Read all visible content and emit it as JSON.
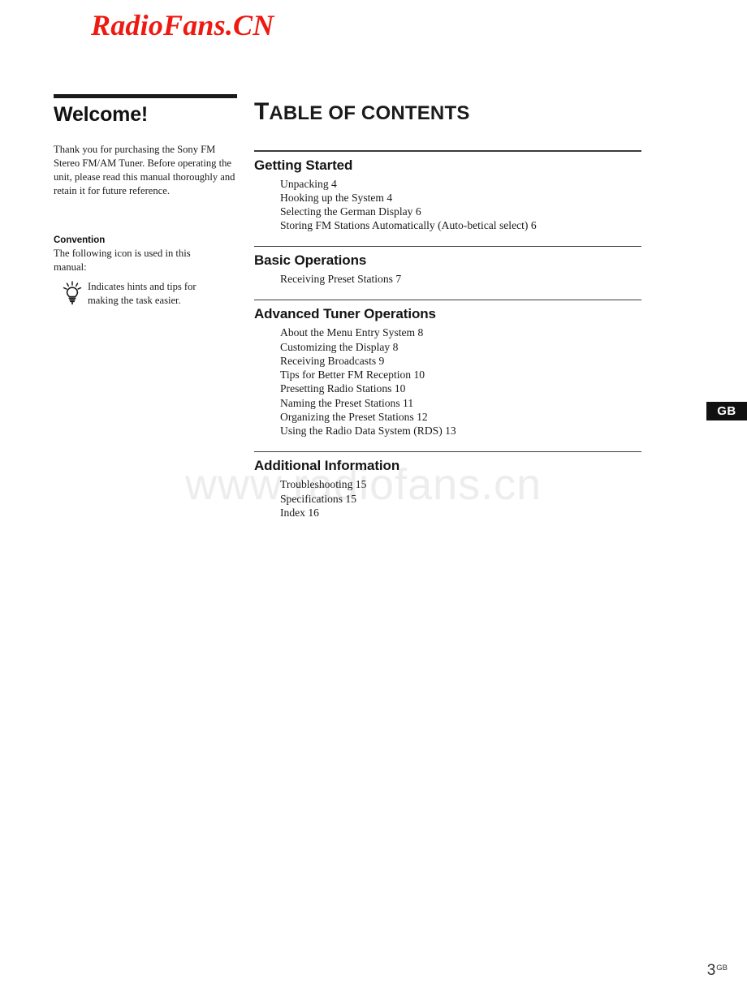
{
  "watermarks": {
    "logo": "RadioFans.CN",
    "logo_color": "#ee1a11",
    "site": "www.radiofans.cn",
    "site_color": "#ededed"
  },
  "left_column": {
    "welcome_title": "Welcome!",
    "welcome_body": "Thank you for purchasing the Sony FM Stereo FM/AM Tuner.  Before operating the unit, please read this manual thoroughly and retain it for future reference.",
    "convention_title": "Convention",
    "convention_body": "The following icon is used in this manual:",
    "tip_icon_name": "lightbulb-icon",
    "tip_text": "Indicates hints and tips for making the task easier."
  },
  "toc": {
    "title_cap": "T",
    "title_rest": "ABLE OF CONTENTS",
    "sections": [
      {
        "heading": "Getting Started",
        "entries": [
          "Unpacking 4",
          "Hooking up the System 4",
          "Selecting the German Display 6",
          "Storing FM Stations Automatically (Auto-betical select) 6"
        ]
      },
      {
        "heading": "Basic Operations",
        "entries": [
          "Receiving Preset Stations 7"
        ]
      },
      {
        "heading": "Advanced Tuner Operations",
        "entries": [
          "About the Menu Entry System 8",
          "Customizing the Display 8",
          "Receiving Broadcasts 9",
          "Tips for Better FM Reception 10",
          "Presetting Radio Stations 10",
          "Naming the Preset Stations 11",
          "Organizing the Preset Stations 12",
          "Using the Radio Data System (RDS) 13"
        ]
      },
      {
        "heading": "Additional Information",
        "entries": [
          "Troubleshooting 15",
          "Specifications 15",
          "Index 16"
        ]
      }
    ]
  },
  "side_tab": {
    "label": "GB"
  },
  "footer": {
    "page_number": "3",
    "region": "GB"
  }
}
